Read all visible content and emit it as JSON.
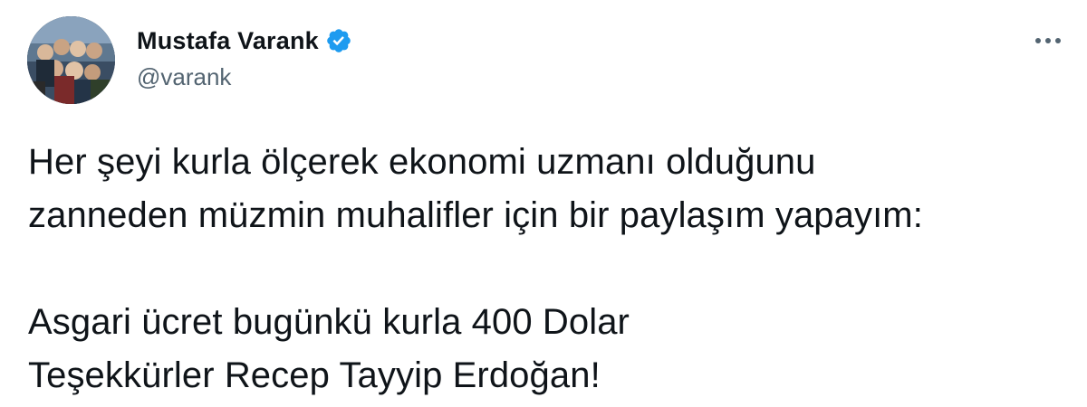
{
  "author": {
    "display_name": "Mustafa Varank",
    "handle": "@varank",
    "verified": true,
    "avatar_icon": "group-photo-avatar"
  },
  "actions": {
    "more_icon": "more-horizontal-icon"
  },
  "tweet": {
    "lines": [
      "Her şeyi kurla ölçerek ekonomi uzmanı olduğunu",
      "zanneden müzmin muhalifler için bir paylaşım yapayım:",
      "Asgari ücret bugünkü kurla 400 Dolar",
      "Teşekkürler Recep Tayyip Erdoğan!"
    ]
  },
  "colors": {
    "verified_blue": "#1d9bf0",
    "text_primary": "#0f1419",
    "text_secondary": "#536471"
  }
}
